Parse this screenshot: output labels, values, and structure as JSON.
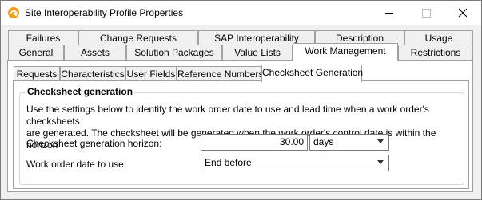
{
  "window": {
    "title": "Site Interoperability Profile Properties"
  },
  "colors": {
    "app_icon": "#f0a020",
    "window_bg": "#f0f0f0",
    "panel_bg": "#ffffff"
  },
  "tabs_row1": [
    "Failures",
    "Change Requests",
    "SAP Interoperability",
    "Description",
    "Usage"
  ],
  "tabs_row2": [
    "General",
    "Assets",
    "Solution Packages",
    "Value Lists",
    "Work Management",
    "Restrictions"
  ],
  "active_outer_tab": "Work Management",
  "inner_tabs": [
    "Requests",
    "Characteristics",
    "User Fields",
    "Reference Numbers",
    "Checksheet Generation"
  ],
  "active_inner_tab": "Checksheet Generation",
  "group": {
    "title": "Checksheet generation",
    "description_line1": "Use the settings below to identify the work order date to use and lead time when a work order's checksheets",
    "description_line2": "are generated.  The checksheet will be generated when the work order's control date is within the horizon"
  },
  "horizon": {
    "label": "Checksheet generation horizon:",
    "value": "30.00",
    "unit": "days"
  },
  "date_to_use": {
    "label": "Work order date to use:",
    "value": "End before"
  }
}
